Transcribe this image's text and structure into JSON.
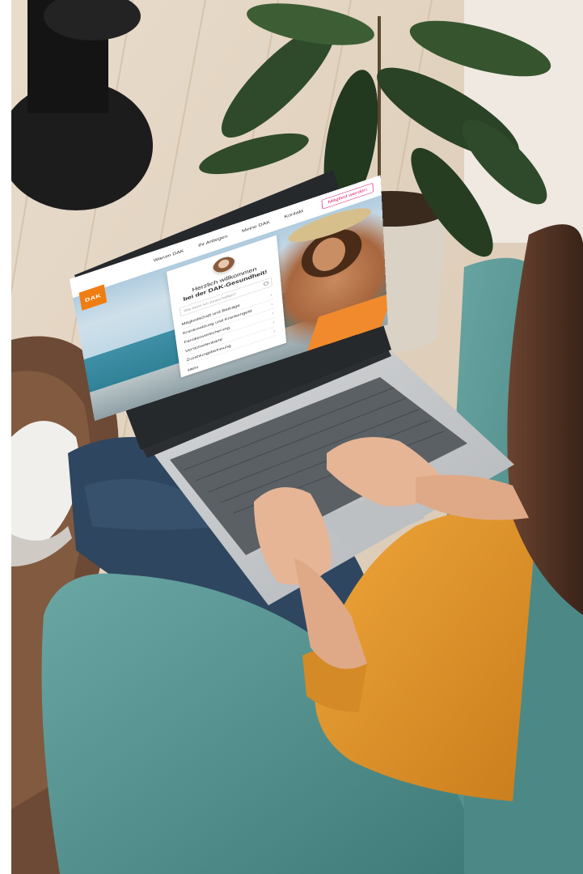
{
  "screen": {
    "logo_text": "DAK",
    "nav": [
      "Warum DAK",
      "Ihr Anliegen",
      "Meine DAK",
      "Kontakt"
    ],
    "member_button": "Mitglied werden",
    "greeting_line1": "Herzlich willkommen",
    "greeting_line2": "bei der DAK-Gesundheit!",
    "search_placeholder": "Wie kann ich Ihnen helfen?",
    "topics": [
      "Mitgliedschaft und Beiträge",
      "Krankmeldung und Krankengeld",
      "Familienversicherung",
      "Versichertenkarte",
      "Zuzahlungsbefreiung"
    ],
    "more_link": "Mehr"
  },
  "colors": {
    "brand_orange": "#f07d12",
    "brand_magenta": "#e2196f",
    "sweater": "#e3962c",
    "armchair": "#4f8f8c",
    "laptop": "#c6c8ca"
  },
  "icons": [
    "search-icon",
    "chevron-right-icon"
  ]
}
